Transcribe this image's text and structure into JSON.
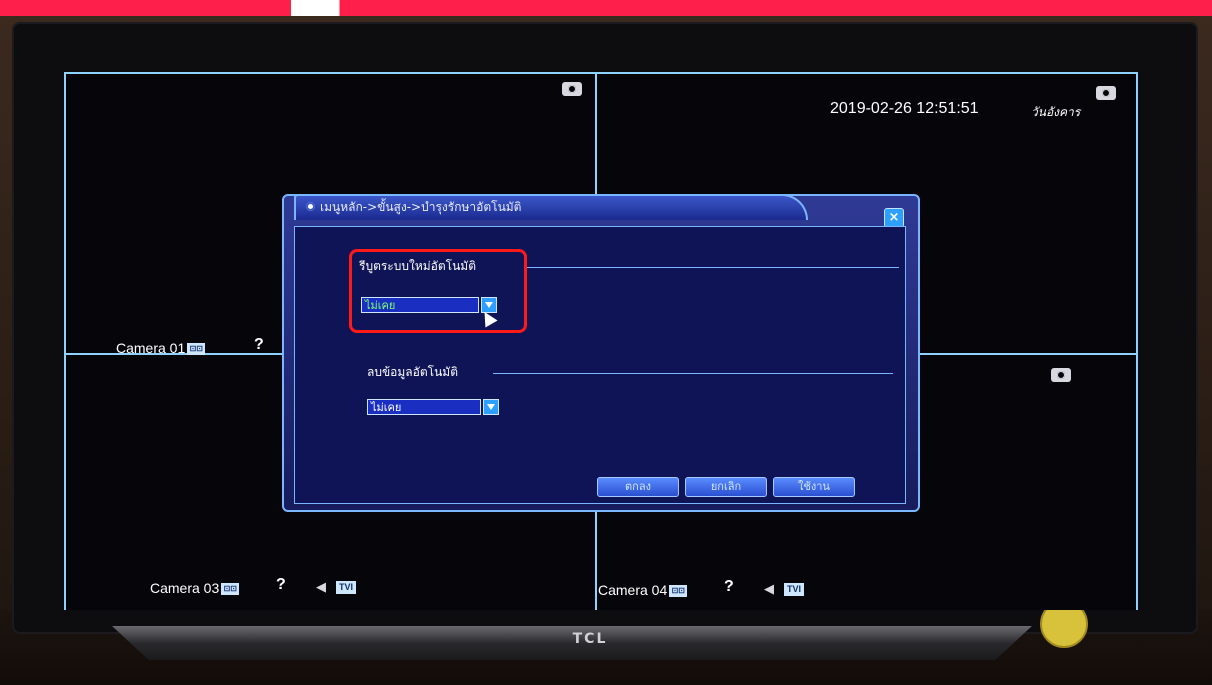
{
  "tv": {
    "brand": "TCL"
  },
  "screen": {
    "datetime": "2019-02-26 12:51:51",
    "weekday": "วันอังคาร",
    "cameras": [
      {
        "label": "Camera 01",
        "badge": "⊡⊡"
      },
      {
        "label": "Camera 03",
        "badge": "⊡⊡",
        "tvi": "TVI"
      },
      {
        "label": "Camera 04",
        "badge": "⊡⊡",
        "tvi": "TVI"
      }
    ],
    "help_symbol": "?",
    "audio_symbol": "◀"
  },
  "dialog": {
    "breadcrumb": "เมนูหลัก->ขั้นสูง->บำรุงรักษาอัตโนมัติ",
    "close_symbol": "×",
    "auto_reboot": {
      "label": "รีบูตระบบใหม่อัตโนมัติ",
      "value": "ไม่เคย"
    },
    "auto_delete": {
      "label": "ลบข้อมูลอัตโนมัติ",
      "value": "ไม่เคย"
    },
    "buttons": {
      "ok": "ตกลง",
      "cancel": "ยกเลิก",
      "apply": "ใช้งาน"
    }
  },
  "colors": {
    "highlight": "#ff1a1a",
    "grid_line": "#8fd2ff",
    "dialog_bg": "#161c5c"
  }
}
